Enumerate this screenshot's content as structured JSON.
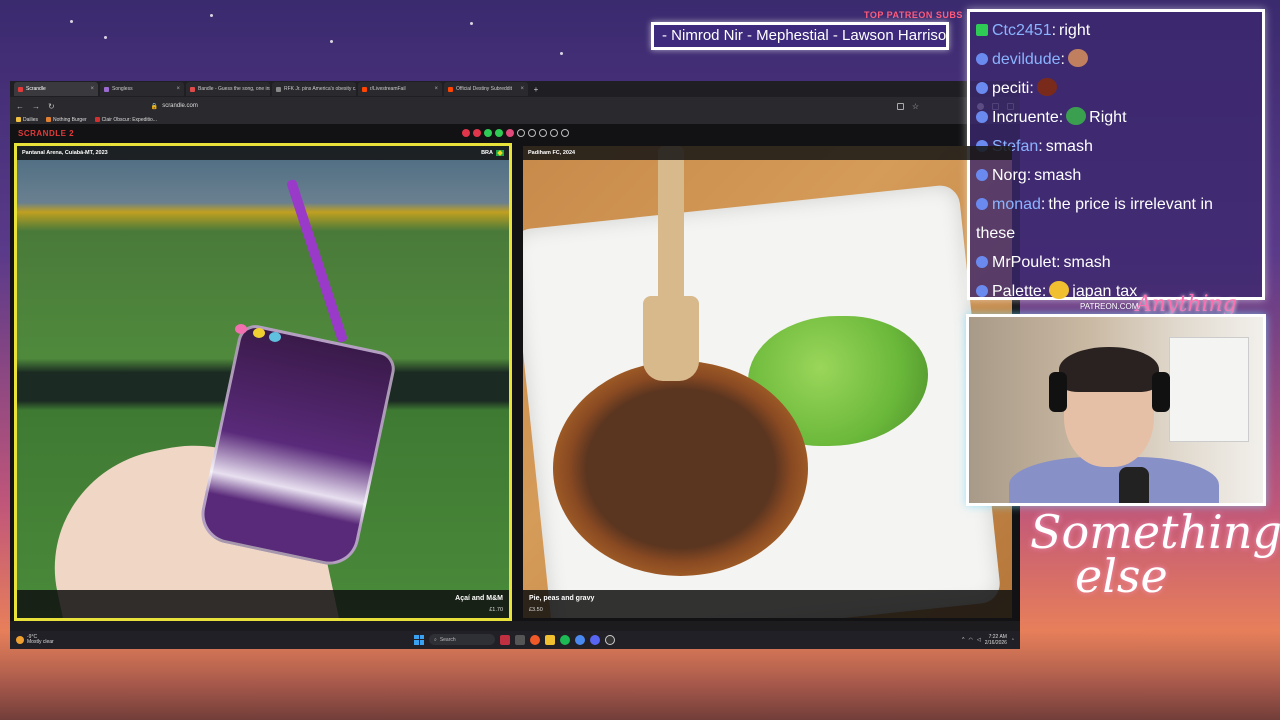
{
  "overlay": {
    "patreon_label": "TOP PATREON SUBS",
    "ticker_text": "- Nimrod Nir - Mephestial - Lawson Harrison",
    "patreon_url": "PATREON.COM/",
    "logo_text": "Anything Else",
    "signature_line1": "Something",
    "signature_line2": "else"
  },
  "browser": {
    "tabs": [
      {
        "label": "Scrandle",
        "color": "#e23a3a"
      },
      {
        "label": "Songless",
        "color": "#9a6ad0"
      },
      {
        "label": "Bandle - Guess the song, one instr...",
        "color": "#e04a4a"
      },
      {
        "label": "RFK Jr. pins America's obesity c...",
        "color": "#888888"
      },
      {
        "label": "r/LivestreamFail",
        "color": "#ff4500"
      },
      {
        "label": "Official Destiny Subreddit",
        "color": "#ff4500"
      }
    ],
    "url": "scrandle.com",
    "bookmarks": [
      {
        "label": "Dailies",
        "color": "#f0c040"
      },
      {
        "label": "Nothing Burger",
        "color": "#e08030"
      },
      {
        "label": "Clair Obscur: Expeditio...",
        "color": "#d03030"
      }
    ]
  },
  "game": {
    "logo": "SCRANDLE 2",
    "progress": [
      "red",
      "red",
      "green",
      "green",
      "pink",
      "empty",
      "empty",
      "empty",
      "empty",
      "empty"
    ],
    "left": {
      "location": "Pantanal Arena, Cuiabá-MT, 2023",
      "country": "BRA",
      "name": "Açaí and M&M",
      "price": "£1.70"
    },
    "right": {
      "location": "Padiham FC, 2024",
      "name": "Pie, peas and gravy",
      "price": "£3.50"
    }
  },
  "taskbar": {
    "temp": "-9°C",
    "weather": "Mostly clear",
    "search": "Search",
    "time": "7:22 AM",
    "date": "2/16/2026"
  },
  "chat": [
    {
      "user": "Ctc2451",
      "text": "right",
      "user_color": "#8ab4ff",
      "badge": "k"
    },
    {
      "user": "devildude",
      "text": "",
      "user_color": "#8ab4ff",
      "emote": "#c08060"
    },
    {
      "user": "peciti",
      "text": "",
      "user_color": "#ffffff",
      "emote": "#7a2a1a"
    },
    {
      "user": "Incruente",
      "text": "Right",
      "user_color": "#ffffff",
      "emote": "#3aa050"
    },
    {
      "user": "Stefan",
      "text": "smash",
      "user_color": "#8ab4ff"
    },
    {
      "user": "Norg",
      "text": "smash",
      "user_color": "#ffffff"
    },
    {
      "user": "monad",
      "text": "the price is irrelevant in these",
      "user_color": "#8ab4ff"
    },
    {
      "user": "MrPoulet",
      "text": "smash",
      "user_color": "#ffffff"
    },
    {
      "user": "Palette",
      "text": "japan tax",
      "user_color": "#ffffff",
      "emote": "#f0c030"
    }
  ]
}
